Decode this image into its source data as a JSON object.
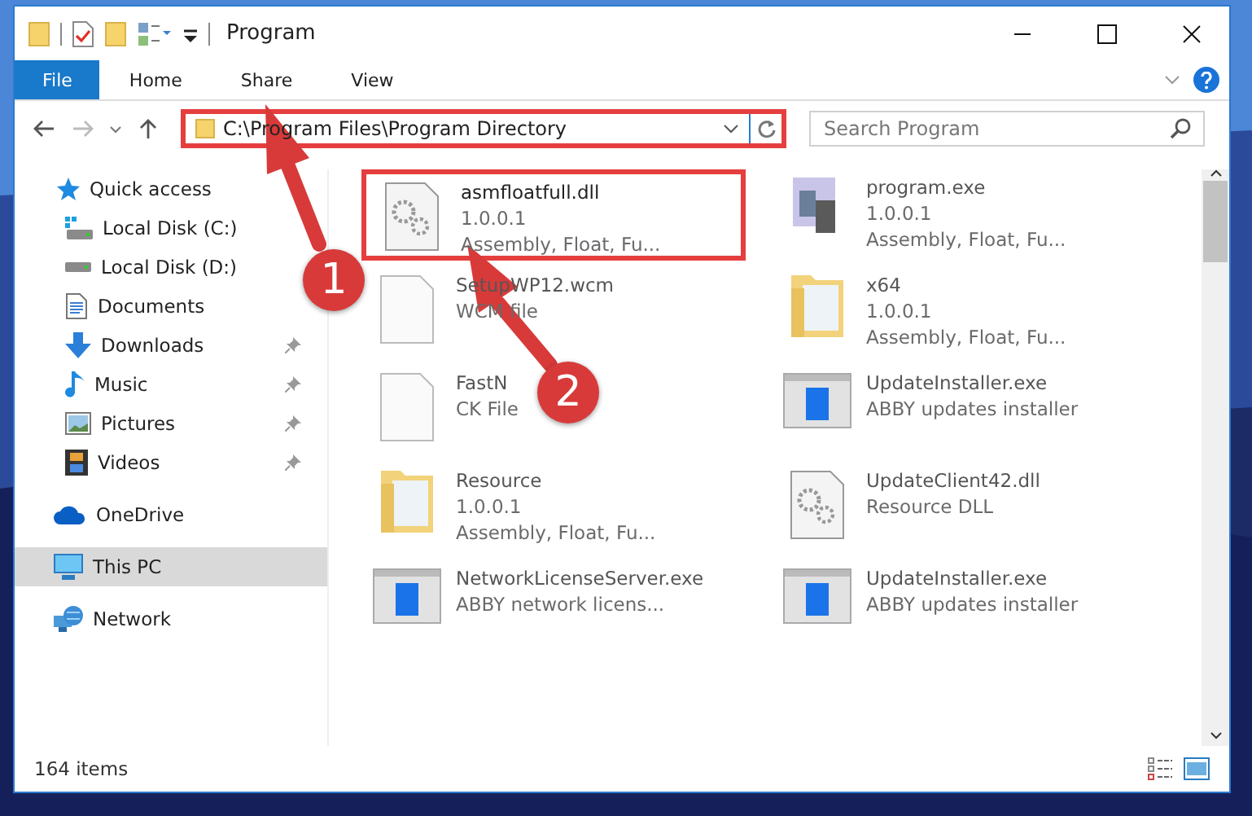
{
  "window": {
    "title": "Program"
  },
  "ribbon_tabs": [
    {
      "label": "File",
      "selected": true
    },
    {
      "label": "Home",
      "selected": false
    },
    {
      "label": "Share",
      "selected": false
    },
    {
      "label": "View",
      "selected": false
    }
  ],
  "address": {
    "value": "C:\\Program Files\\Program Directory",
    "highlighted": true
  },
  "search": {
    "placeholder": "Search Program"
  },
  "sidebar": {
    "items": [
      {
        "label": "Quick access",
        "selected": false,
        "children": [
          {
            "label": "Local Disk (C:)",
            "pinned": false,
            "selected": false
          },
          {
            "label": "Local Disk (D:)",
            "pinned": false,
            "selected": false
          },
          {
            "label": "Documents",
            "pinned": false,
            "selected": false
          },
          {
            "label": "Downloads",
            "pinned": true,
            "selected": false
          },
          {
            "label": "Music",
            "pinned": true,
            "selected": false
          },
          {
            "label": "Pictures",
            "pinned": true,
            "selected": false
          },
          {
            "label": "Videos",
            "pinned": true,
            "selected": false
          }
        ]
      },
      {
        "label": "OneDrive",
        "selected": false
      },
      {
        "label": "This PC",
        "selected": true
      },
      {
        "label": "Network",
        "selected": false
      }
    ]
  },
  "files": [
    {
      "name": "asmfloatfull.dll",
      "details": [
        "1.0.0.1",
        "Assembly, Float, Fu..."
      ],
      "highlighted": true
    },
    {
      "name": "program.exe",
      "details": [
        "1.0.0.1",
        "Assembly, Float, Fu..."
      ],
      "highlighted": false
    },
    {
      "name": "SetupWP12.wcm",
      "details": [
        "WCM file"
      ],
      "highlighted": false
    },
    {
      "name": "x64",
      "details": [
        "1.0.0.1",
        "Assembly, Float, Fu..."
      ],
      "highlighted": false
    },
    {
      "name": "FastN",
      "details": [
        "CK File"
      ],
      "highlighted": false
    },
    {
      "name": "UpdateInstaller.exe",
      "details": [
        "ABBY updates installer"
      ],
      "highlighted": false
    },
    {
      "name": "Resource",
      "details": [
        "1.0.0.1",
        "Assembly, Float, Fu..."
      ],
      "highlighted": false
    },
    {
      "name": "UpdateClient42.dll",
      "details": [
        "Resource DLL"
      ],
      "highlighted": false
    },
    {
      "name": "NetworkLicenseServer.exe",
      "details": [
        "ABBY network licens..."
      ],
      "highlighted": false
    },
    {
      "name": "UpdateInstaller.exe",
      "details": [
        "ABBY updates installer"
      ],
      "highlighted": false
    }
  ],
  "status_bar": {
    "item_count": "164 items"
  },
  "annotations": [
    {
      "number": "1"
    },
    {
      "number": "2"
    }
  ]
}
